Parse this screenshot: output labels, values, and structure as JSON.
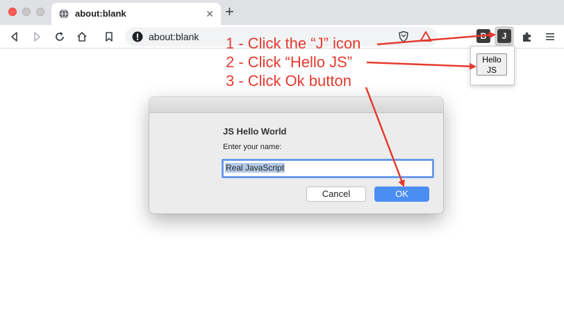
{
  "tab": {
    "title": "about:blank",
    "close": "✕"
  },
  "newtab": "+",
  "omnibox": {
    "url": "about:blank"
  },
  "extensions": {
    "b_label": "B",
    "j_label": "J"
  },
  "popup": {
    "button_line1": "Hello",
    "button_line2": "JS"
  },
  "dialog": {
    "title": "JS Hello World",
    "message": "Enter your name:",
    "input_value": "Real JavaScript",
    "cancel_label": "Cancel",
    "ok_label": "OK"
  },
  "annotations": {
    "step1": "1 - Click the “J” icon",
    "step2": "2 - Click “Hello JS”",
    "step3": "3 - Click Ok button"
  },
  "colors": {
    "annotation": "#e53a2f",
    "ok_button": "#4a8ef3",
    "traffic_red": "#ff5f57"
  },
  "icons": [
    "globe-icon",
    "back-icon",
    "forward-icon",
    "reload-icon",
    "home-icon",
    "bookmark-icon",
    "info-icon",
    "brave-shield-icon",
    "brave-rewards-icon",
    "puzzle-icon",
    "menu-icon"
  ]
}
